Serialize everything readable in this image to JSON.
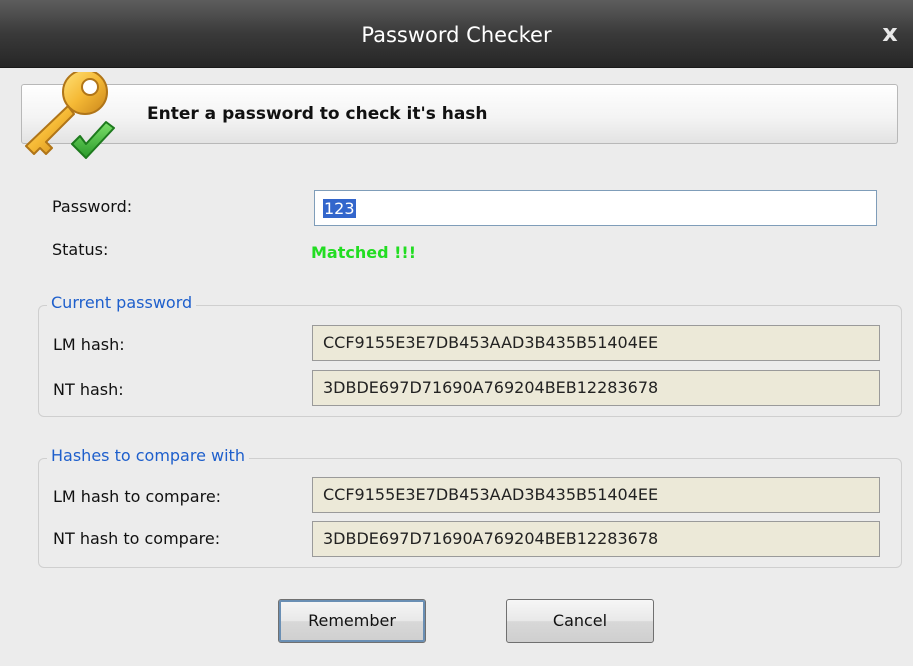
{
  "window": {
    "title": "Password Checker",
    "close_glyph": "x"
  },
  "banner": {
    "icon": "key-check-icon",
    "text": "Enter a password to check it's hash"
  },
  "form": {
    "password_label": "Password:",
    "password_value": "123",
    "status_label": "Status:",
    "status_value": "Matched !!!",
    "status_color": "#22dd22"
  },
  "current_password": {
    "legend": "Current password",
    "lm_label": "LM hash:",
    "lm_value": "CCF9155E3E7DB453AAD3B435B51404EE",
    "nt_label": "NT hash:",
    "nt_value": "3DBDE697D71690A769204BEB12283678"
  },
  "compare": {
    "legend": "Hashes to compare with",
    "lm_label": "LM hash to compare:",
    "lm_value": "CCF9155E3E7DB453AAD3B435B51404EE",
    "nt_label": "NT hash to compare:",
    "nt_value": "3DBDE697D71690A769204BEB12283678"
  },
  "buttons": {
    "remember": "Remember",
    "cancel": "Cancel"
  },
  "colors": {
    "legend": "#1e5fcc",
    "selection": "#3366cc"
  }
}
